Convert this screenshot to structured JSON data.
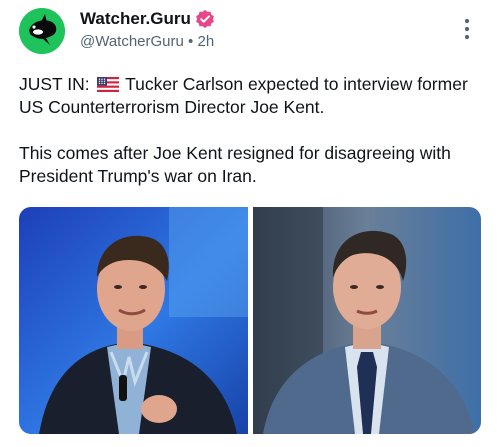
{
  "header": {
    "display_name": "Watcher.Guru",
    "handle": "@WatcherGuru",
    "separator": "•",
    "time": "2h",
    "avatar_icon": "orca-icon",
    "verified_icon": "verified-badge-icon",
    "more_icon": "more-vertical-icon"
  },
  "tweet": {
    "prefix": "JUST IN:",
    "flag_icon": "us-flag-icon",
    "line1_rest": "Tucker Carlson expected to interview former US Counterterrorism Director Joe Kent.",
    "paragraph2": "This comes after Joe Kent resigned for disagreeing with President Trump's war on Iran."
  },
  "media": {
    "photo_left_icon": "photo-tucker-carlson",
    "photo_right_icon": "photo-joe-kent"
  },
  "colors": {
    "brand_green": "#1fc35c",
    "verified_pink": "#e8478b",
    "text": "#0f1419",
    "muted": "#536471"
  }
}
